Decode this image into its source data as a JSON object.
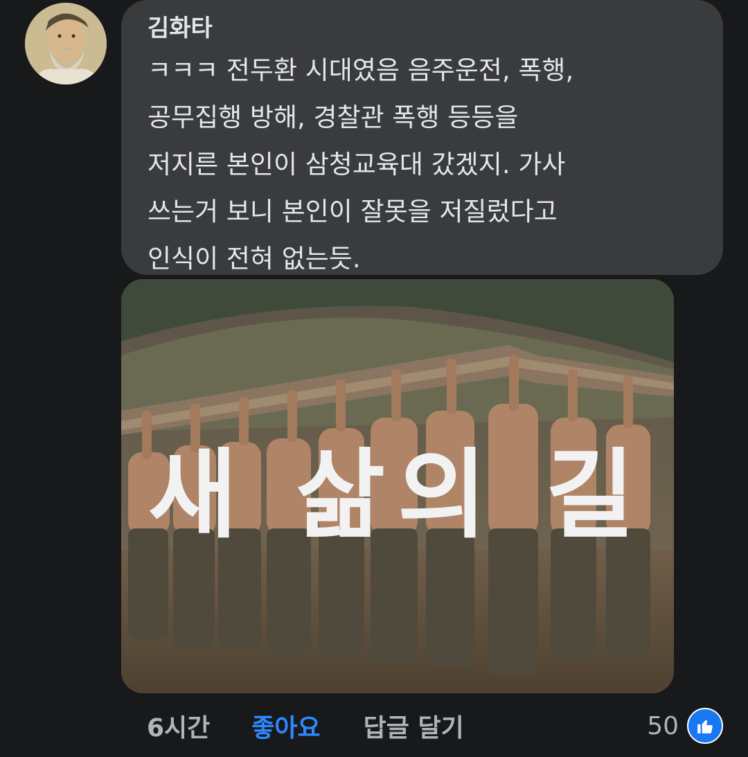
{
  "comment": {
    "author": "김화타",
    "text_lines": [
      "ㅋㅋㅋ 전두환 시대였음 음주운전, 폭행,",
      "공무집행 방해, 경찰관 폭행 등등을",
      "저지른 본인이 삼청교육대 갔겠지. 가사",
      "쓰는거 보니 본인이 잘못을 저질렀다고",
      "인식이 전혀 없는듯."
    ]
  },
  "attachment": {
    "overlay_text": "새 삶의 길",
    "icon": "photo"
  },
  "actions": {
    "time": "6시간",
    "like_label": "좋아요",
    "reply_label": "답글 달기"
  },
  "reactions": {
    "count": "50",
    "icon": "thumbs-up-icon"
  },
  "colors": {
    "background": "#18191a",
    "bubble": "#3a3b3c",
    "text": "#e4e6eb",
    "muted": "#b0b3b8",
    "accent": "#2d88ff",
    "like_badge": "#1877f2"
  }
}
